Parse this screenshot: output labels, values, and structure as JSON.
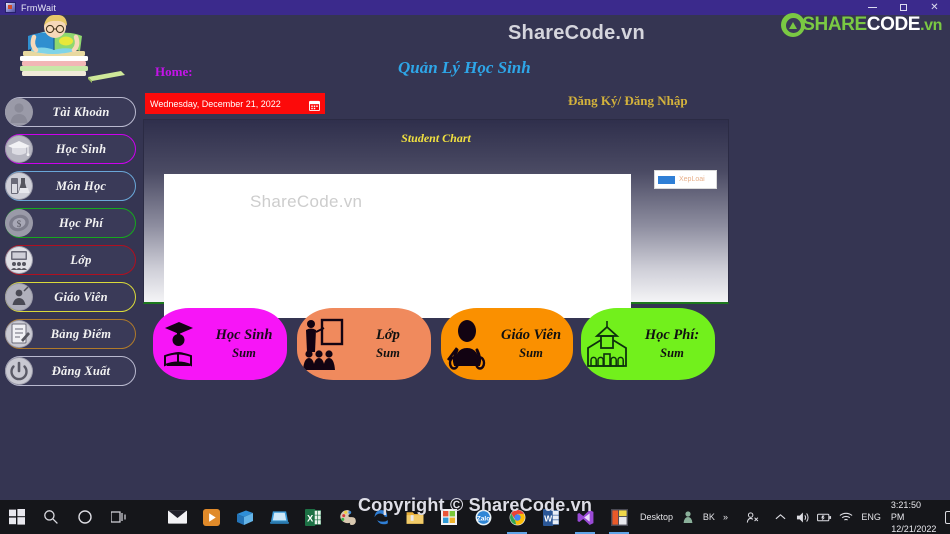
{
  "window": {
    "title": "FrmWait",
    "icon": "app-icon",
    "minimize": "–",
    "maximize": "❐",
    "close": "✕"
  },
  "sidebar": {
    "logo": "student-reading-books-logo",
    "items": [
      {
        "label": "Tài Khoản",
        "icon": "user-icon",
        "accent": "#b9b9cf"
      },
      {
        "label": "Học Sinh",
        "icon": "graduation-cap-icon",
        "accent": "#cc00ee"
      },
      {
        "label": "Môn Học",
        "icon": "flask-icon",
        "accent": "#6aa7d8"
      },
      {
        "label": "Học Phí",
        "icon": "money-icon",
        "accent": "#16a81e"
      },
      {
        "label": "Lớp",
        "icon": "classroom-icon",
        "accent": "#b01020"
      },
      {
        "label": "Giáo Viên",
        "icon": "teacher-icon",
        "accent": "#d9d93a"
      },
      {
        "label": "Bảng Điểm",
        "icon": "report-card-icon",
        "accent": "#b07a2a"
      },
      {
        "label": "Đăng Xuất",
        "icon": "power-icon",
        "accent": "#b9b9cf"
      }
    ]
  },
  "header": {
    "sharecode_title": "ShareCode.vn",
    "home_label": "Home:",
    "app_subtitle": "Quản Lý Học Sinh",
    "auth_link": "Đăng Ký/ Đăng Nhập",
    "date_value": "Wednesday, December 21, 2022",
    "date_icon": "calendar-icon",
    "brand": {
      "part1": "SHARE",
      "part2": "CODE",
      "part3": ".vn",
      "badge": "sharecode-badge-icon"
    }
  },
  "chart_panel": {
    "title": "Student Chart",
    "watermark": "ShareCode.vn",
    "legend_label": "XepLoai",
    "legend_color": "#2f7fd6"
  },
  "chart_data": {
    "type": "bar",
    "title": "Student Chart",
    "categories": [],
    "values": [],
    "series": [
      {
        "name": "XepLoai",
        "values": [],
        "color": "#2f7fd6"
      }
    ],
    "xlabel": "",
    "ylabel": "",
    "legend_position": "right",
    "grid": false,
    "note": "Plot area is blank — no bars rendered; only the XepLoai legend entry is shown."
  },
  "summary_buttons": [
    {
      "name": "Học Sinh",
      "sum_label": "Sum",
      "color": "#f715f7",
      "icon": "student-reading-icon"
    },
    {
      "name": "Lớp",
      "sum_label": "Sum",
      "color": "#f08a5d",
      "icon": "classroom-group-icon"
    },
    {
      "name": "Giáo Viên",
      "sum_label": "Sum",
      "color": "#fa9000",
      "icon": "teacher-pointer-icon"
    },
    {
      "name": "Học Phí:",
      "sum_label": "Sum",
      "color": "#72f01c",
      "icon": "school-building-icon"
    }
  ],
  "footer": {
    "copyright": "Copyright © ShareCode.vn"
  },
  "taskbar": {
    "start": "start-icon",
    "search": "search-icon",
    "cortana": "cortana-icon",
    "taskview": "task-view-icon",
    "apps": [
      "mail-icon",
      "media-player-icon",
      "store-icon",
      "remote-desktop-icon",
      "excel-icon",
      "paint-icon",
      "edge-legacy-icon",
      "file-explorer-icon",
      "microsoft-icon",
      "zalo-icon",
      "chrome-icon",
      "word-icon",
      "visual-studio-icon",
      "winforms-designer-icon"
    ],
    "tray": {
      "desktop_label": "Desktop",
      "bk_label": "BK",
      "overflow": "»",
      "people_icon": "people-icon",
      "chevron_icon": "chevron-up-icon",
      "volume_icon": "volume-icon",
      "battery_icon": "battery-icon",
      "network_icon": "wifi-icon",
      "language": "ENG",
      "time": "3:21:50 PM",
      "date": "12/21/2022",
      "action_center": "action-center-icon"
    }
  }
}
